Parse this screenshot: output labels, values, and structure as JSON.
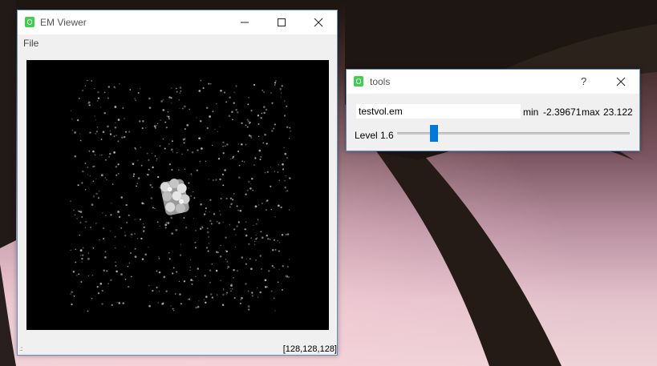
{
  "em_viewer": {
    "title": "EM Viewer",
    "menu": [
      "File"
    ],
    "dimensions_status": "[128,128,128]",
    "icons": {
      "app": "qt-app-icon",
      "minimize": "minimize-icon",
      "maximize": "maximize-icon",
      "close": "close-icon"
    }
  },
  "tools": {
    "title": "tools",
    "help_label": "?",
    "filename": "testvol.em",
    "min_label": "min",
    "min_value": "-2.39671",
    "max_label": "max",
    "max_value": "23.122",
    "level_label": "Level",
    "level_value": "1.6",
    "level_fraction": 0.16,
    "slider_color": "#0078d7"
  }
}
